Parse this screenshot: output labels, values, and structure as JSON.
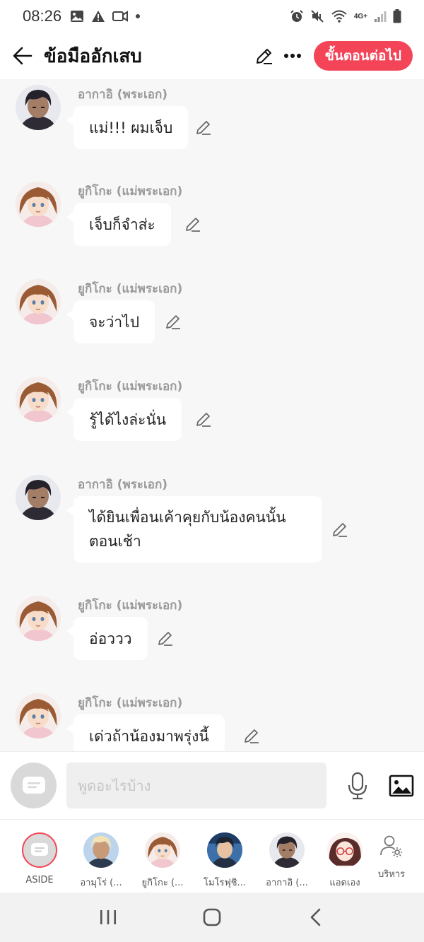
{
  "status_bar": {
    "time": "08:26",
    "network": "4G+"
  },
  "header": {
    "title": "ข้อมืออักเสบ",
    "next_label": "ขั้นตอนต่อไป"
  },
  "messages": [
    {
      "sender": "อากาอิ (พระเอก)",
      "text": "แม่!!! ผมเจ็บ",
      "avatar": "akai"
    },
    {
      "sender": "ยูกิโกะ (แม่พระเอก)",
      "text": "เจ็บก็จำส่ะ",
      "avatar": "yukiko"
    },
    {
      "sender": "ยูกิโกะ (แม่พระเอก)",
      "text": "จะว่าไป",
      "avatar": "yukiko"
    },
    {
      "sender": "ยูกิโกะ (แม่พระเอก)",
      "text": "รู้ได้ไงล่ะนั่น",
      "avatar": "yukiko"
    },
    {
      "sender": "อากาอิ (พระเอก)",
      "text": "ได้ยินเพื่อนเค้าคุยกับน้องคนนั้น\nตอนเช้า",
      "avatar": "akai"
    },
    {
      "sender": "ยูกิโกะ (แม่พระเอก)",
      "text": "อ่อววว",
      "avatar": "yukiko"
    },
    {
      "sender": "ยูกิโกะ (แม่พระเอก)",
      "text": "เด่วถ้าน้องมาพรุ่งนี้",
      "avatar": "yukiko"
    }
  ],
  "input": {
    "placeholder": "พูดอะไรบ้าง"
  },
  "characters": [
    {
      "label": "ASIDE",
      "avatar": "aside"
    },
    {
      "label": "อามุโร่ (...",
      "avatar": "amuro"
    },
    {
      "label": "ยูกิโกะ (...",
      "avatar": "yukiko"
    },
    {
      "label": "โมโรฟุชิ...",
      "avatar": "morofushi"
    },
    {
      "label": "อากาอิ (...",
      "avatar": "akai"
    },
    {
      "label": "แอดเอง",
      "avatar": "admin"
    }
  ],
  "manage_label": "บริหาร",
  "colors": {
    "accent": "#f44458",
    "background": "#f7f7f7",
    "bubble": "#ffffff"
  }
}
